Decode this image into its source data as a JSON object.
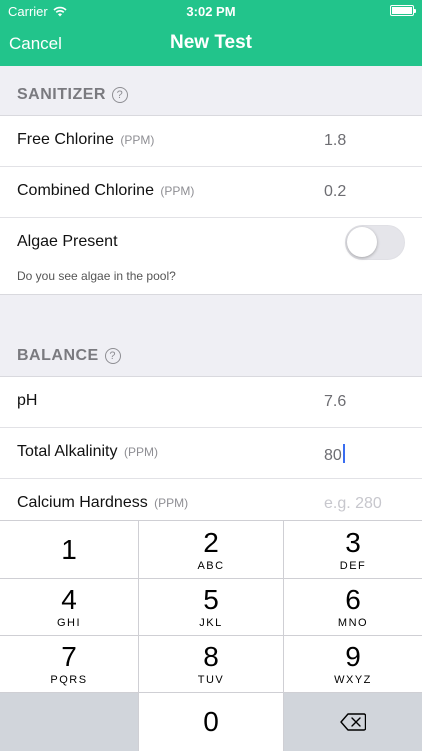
{
  "status_bar": {
    "carrier": "Carrier",
    "time": "3:02 PM"
  },
  "nav": {
    "cancel_label": "Cancel",
    "title": "New Test"
  },
  "sanitizer": {
    "header": "SANITIZER",
    "rows": [
      {
        "label": "Free Chlorine",
        "unit": "(PPM)",
        "value": "1.8"
      },
      {
        "label": "Combined Chlorine",
        "unit": "(PPM)",
        "value": "0.2"
      }
    ],
    "algae": {
      "label": "Algae Present",
      "note": "Do you see algae in the pool?",
      "on": false
    }
  },
  "balance": {
    "header": "BALANCE",
    "rows": [
      {
        "label": "pH",
        "unit": "",
        "value": "7.6"
      },
      {
        "label": "Total Alkalinity",
        "unit": "(PPM)",
        "value": "80"
      },
      {
        "label": "Calcium Hardness",
        "unit": "(PPM)",
        "placeholder": "e.g. 280"
      }
    ]
  },
  "keypad": {
    "keys": [
      {
        "digit": "1",
        "letters": ""
      },
      {
        "digit": "2",
        "letters": "ABC"
      },
      {
        "digit": "3",
        "letters": "DEF"
      },
      {
        "digit": "4",
        "letters": "GHI"
      },
      {
        "digit": "5",
        "letters": "JKL"
      },
      {
        "digit": "6",
        "letters": "MNO"
      },
      {
        "digit": "7",
        "letters": "PQRS"
      },
      {
        "digit": "8",
        "letters": "TUV"
      },
      {
        "digit": "9",
        "letters": "WXYZ"
      },
      {
        "digit": "0",
        "letters": ""
      }
    ]
  },
  "colors": {
    "accent": "#22c48b",
    "cursor": "#3a6df0"
  }
}
